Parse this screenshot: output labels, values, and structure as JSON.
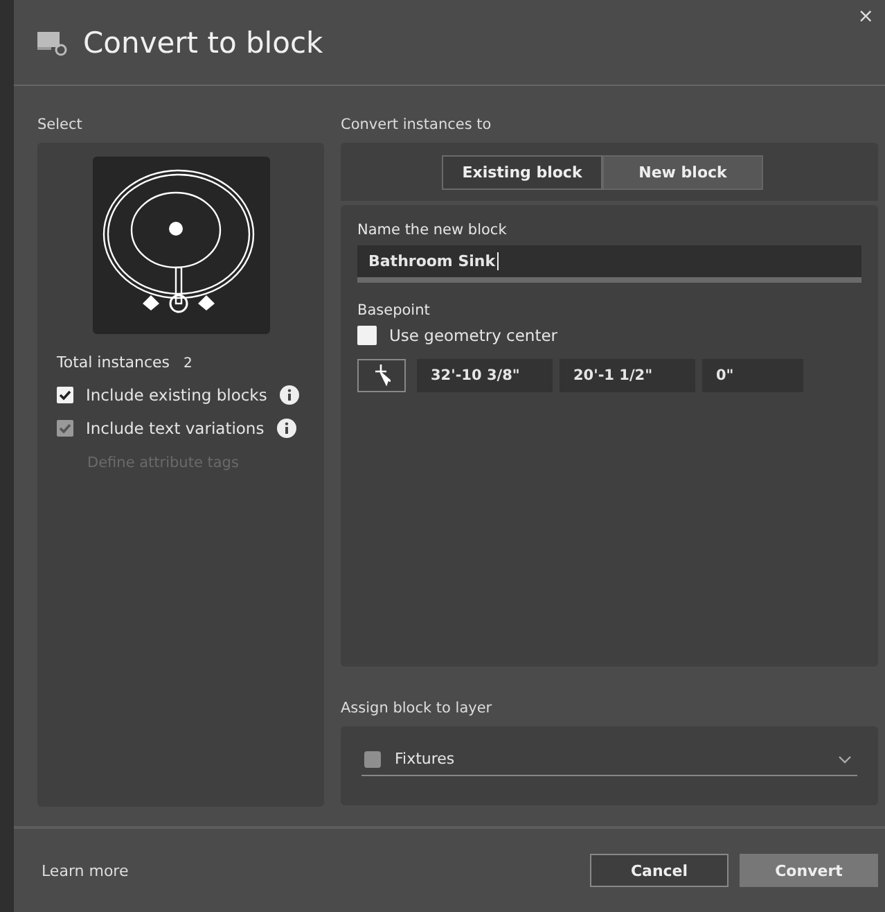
{
  "window": {
    "title": "Convert to block",
    "close": "×"
  },
  "select": {
    "label": "Select",
    "total_label": "Total instances",
    "total_value": "2",
    "options": [
      {
        "label": "Include existing blocks",
        "checked": true,
        "disabled": false,
        "info": true
      },
      {
        "label": "Include text variations",
        "checked": true,
        "disabled": true,
        "info": true
      }
    ],
    "link": {
      "label": "Define attribute tags",
      "disabled": true
    }
  },
  "convert": {
    "label": "Convert instances to",
    "tabs": [
      {
        "label": "Existing block",
        "selected": false
      },
      {
        "label": "New block",
        "selected": true
      }
    ],
    "name_label": "Name the new block",
    "name_value": "Bathroom Sink",
    "basepoint_label": "Basepoint",
    "use_center": {
      "label": "Use geometry center",
      "checked": false
    },
    "coords": [
      "32'-10 3/8\"",
      "20'-1 1/2\"",
      "0\""
    ]
  },
  "layer": {
    "label": "Assign block to layer",
    "value": "Fixtures",
    "color": "#8e8e8e"
  },
  "footer": {
    "link": "Learn more",
    "buttons": [
      {
        "label": "Cancel",
        "kind": "secondary"
      },
      {
        "label": "Convert",
        "kind": "primary"
      }
    ]
  }
}
